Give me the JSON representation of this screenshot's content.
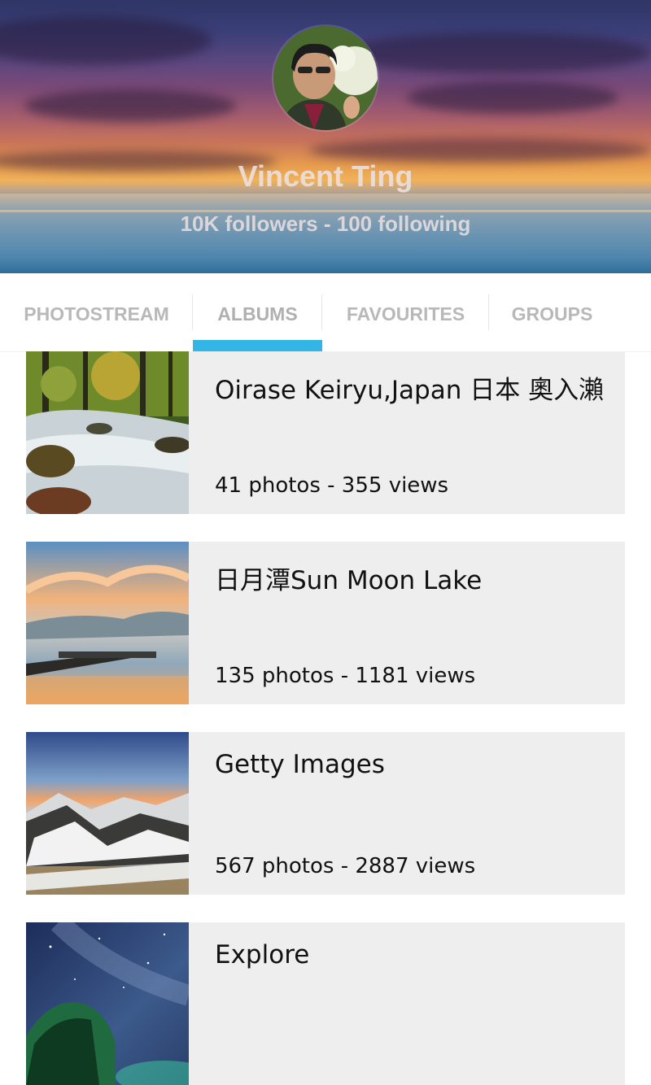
{
  "profile": {
    "name": "Vincent Ting",
    "stats": "10K followers - 100 following"
  },
  "tabs": [
    {
      "label": "PHOTOSTREAM",
      "active": false
    },
    {
      "label": "ALBUMS",
      "active": true
    },
    {
      "label": "FAVOURITES",
      "active": false
    },
    {
      "label": "GROUPS",
      "active": false
    }
  ],
  "albums": [
    {
      "title": "Oirase Keiryu,Japan 日本 奧入瀨",
      "meta": "41 photos - 355 views"
    },
    {
      "title": "日月潭Sun Moon Lake",
      "meta": "135 photos - 1181 views"
    },
    {
      "title": "Getty Images",
      "meta": "567 photos - 2887 views"
    },
    {
      "title": "Explore",
      "meta": ""
    }
  ],
  "colors": {
    "accent": "#33b5e5",
    "card_bg": "#eeeeee",
    "tab_text": "#b8b8b8"
  }
}
